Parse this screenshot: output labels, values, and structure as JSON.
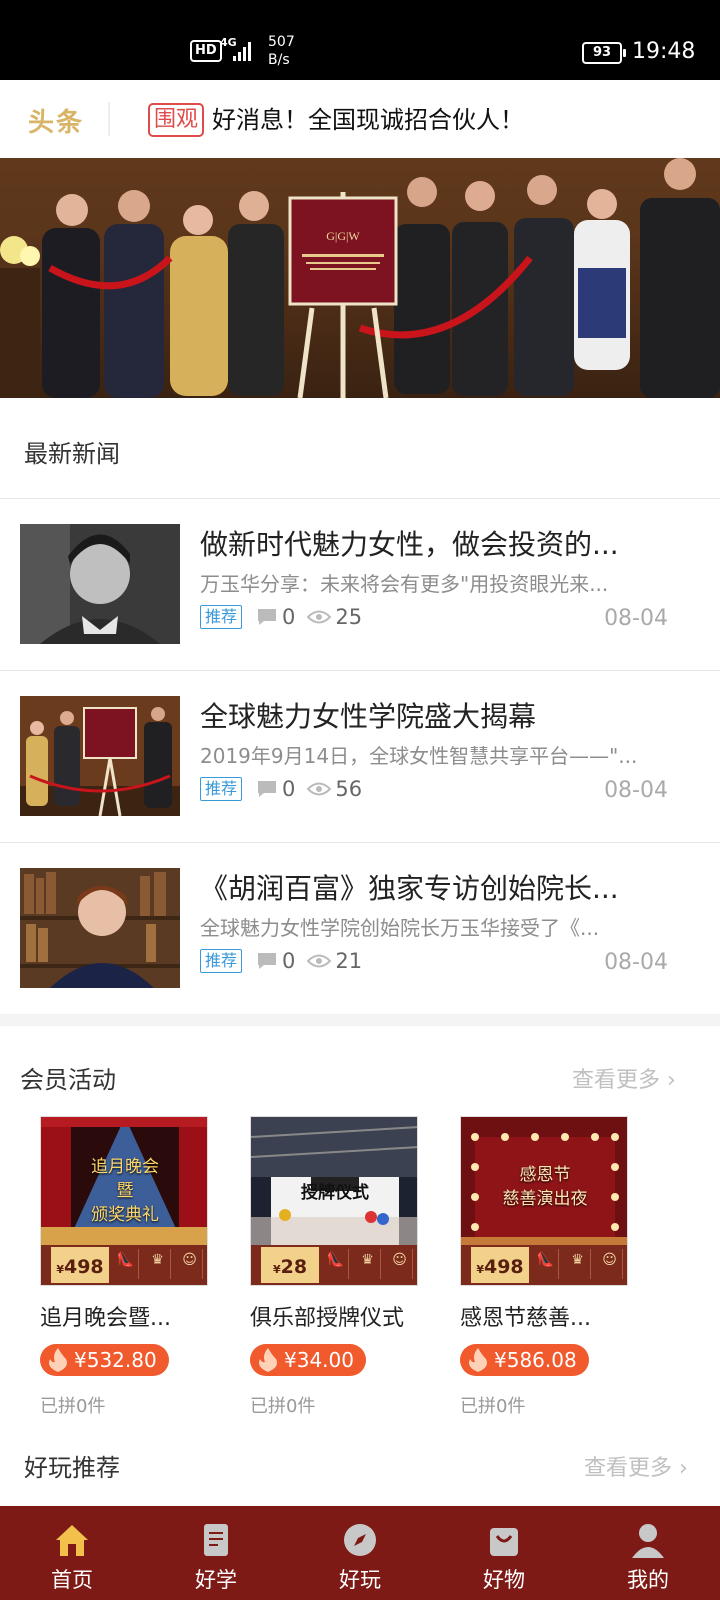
{
  "status_bar": {
    "hd": "HD",
    "network": "4G",
    "rate_value": "507",
    "rate_unit": "B/s",
    "battery": "93",
    "time": "19:48"
  },
  "ticker": {
    "logo": "头条",
    "tag": "围观",
    "text": "好消息！全国现诚招合伙人！"
  },
  "banner": {
    "plaque_text": "G|G|W",
    "slides": 2,
    "active_slide": 0
  },
  "latest_news": {
    "title": "最新新闻",
    "items": [
      {
        "title": "做新时代魅力女性，做会投资的...",
        "summary": "万玉华分享：未来将会有更多\"用投资眼光来...",
        "badge": "推荐",
        "comments": "0",
        "views": "25",
        "date": "08-04",
        "thumb": "woman-portrait-bw"
      },
      {
        "title": "全球魅力女性学院盛大揭幕",
        "summary": "2019年9月14日，全球女性智慧共享平台——\"...",
        "badge": "推荐",
        "comments": "0",
        "views": "56",
        "date": "08-04",
        "thumb": "ribbon-ceremony"
      },
      {
        "title": "《胡润百富》独家专访创始院长...",
        "summary": "全球魅力女性学院创始院长万玉华接受了《...",
        "badge": "推荐",
        "comments": "0",
        "views": "21",
        "date": "08-04",
        "thumb": "woman-library"
      }
    ]
  },
  "member_activities": {
    "title": "会员活动",
    "more": "查看更多",
    "items": [
      {
        "poster_title_1": "追月晚会",
        "poster_title_2": "暨",
        "poster_title_3": "颁奖典礼",
        "poster_price": "498",
        "name": "追月晚会暨...",
        "price": "¥532.80",
        "sold": "已拼0件"
      },
      {
        "poster_title_1": "授牌仪式",
        "poster_title_2": "",
        "poster_title_3": "",
        "poster_price": "28",
        "name": "俱乐部授牌仪式",
        "price": "¥34.00",
        "sold": "已拼0件"
      },
      {
        "poster_title_1": "感恩节",
        "poster_title_2": "慈善演出夜",
        "poster_title_3": "",
        "poster_price": "498",
        "name": "感恩节慈善...",
        "price": "¥586.08",
        "sold": "已拼0件"
      }
    ]
  },
  "fun_recommend": {
    "title": "好玩推荐",
    "more": "查看更多"
  },
  "bottom_nav": [
    {
      "label": "首页",
      "icon": "home-icon",
      "active": true
    },
    {
      "label": "好学",
      "icon": "notebook-icon",
      "active": false
    },
    {
      "label": "好玩",
      "icon": "compass-icon",
      "active": false
    },
    {
      "label": "好物",
      "icon": "shopping-bag-icon",
      "active": false
    },
    {
      "label": "我的",
      "icon": "user-icon",
      "active": false
    }
  ],
  "colors": {
    "accent": "#7d1a16",
    "ticker_logo": "#d8b466",
    "tag_red": "#e04b4b",
    "badge_blue": "#3a9ad9",
    "price_orange": "#f05a2c"
  }
}
